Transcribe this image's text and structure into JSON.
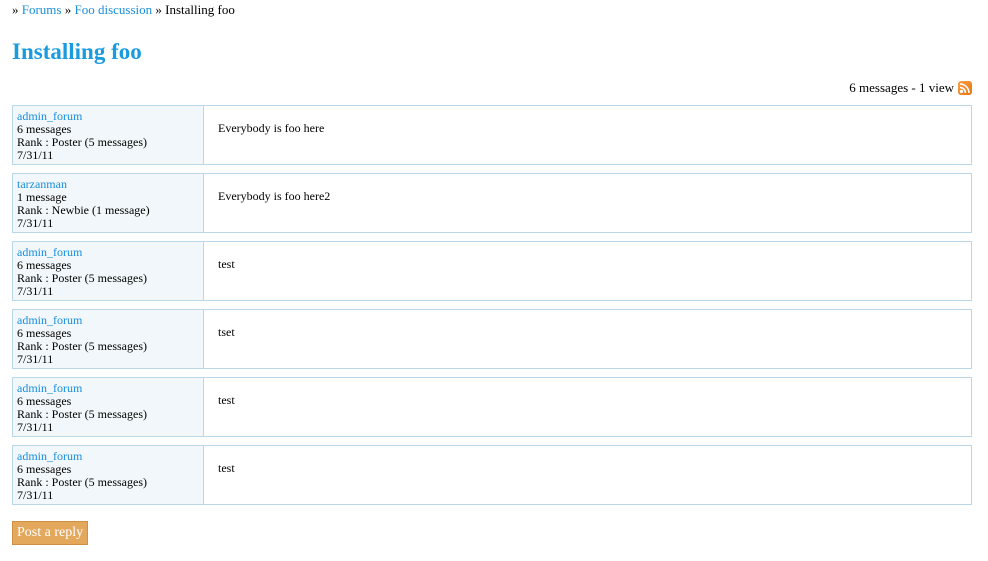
{
  "breadcrumb": {
    "prefix": "»",
    "forums": "Forums",
    "sep1": "»",
    "category": "Foo discussion",
    "sep2": "»",
    "current": "Installing foo"
  },
  "title": "Installing foo",
  "stats": {
    "text": "6 messages - 1 view",
    "icon": "rss-feed-icon",
    "icon_color": "#f08a24"
  },
  "posts": [
    {
      "author": "admin_forum",
      "messages": "6 messages",
      "rank": "Rank : Poster (5 messages)",
      "date": "7/31/11",
      "body": "Everybody is foo here"
    },
    {
      "author": "tarzanman",
      "messages": "1 message",
      "rank": "Rank : Newbie (1 message)",
      "date": "7/31/11",
      "body": "Everybody is foo here2"
    },
    {
      "author": "admin_forum",
      "messages": "6 messages",
      "rank": "Rank : Poster (5 messages)",
      "date": "7/31/11",
      "body": "test"
    },
    {
      "author": "admin_forum",
      "messages": "6 messages",
      "rank": "Rank : Poster (5 messages)",
      "date": "7/31/11",
      "body": "tset"
    },
    {
      "author": "admin_forum",
      "messages": "6 messages",
      "rank": "Rank : Poster (5 messages)",
      "date": "7/31/11",
      "body": "test"
    },
    {
      "author": "admin_forum",
      "messages": "6 messages",
      "rank": "Rank : Poster (5 messages)",
      "date": "7/31/11",
      "body": "test"
    }
  ],
  "reply_button": "Post a reply",
  "colors": {
    "link": "#1a8fd9",
    "title": "#1a9be0",
    "border": "#b9d7e8",
    "author_bg": "#f1f7fa",
    "button_bg": "#e3a85c"
  }
}
